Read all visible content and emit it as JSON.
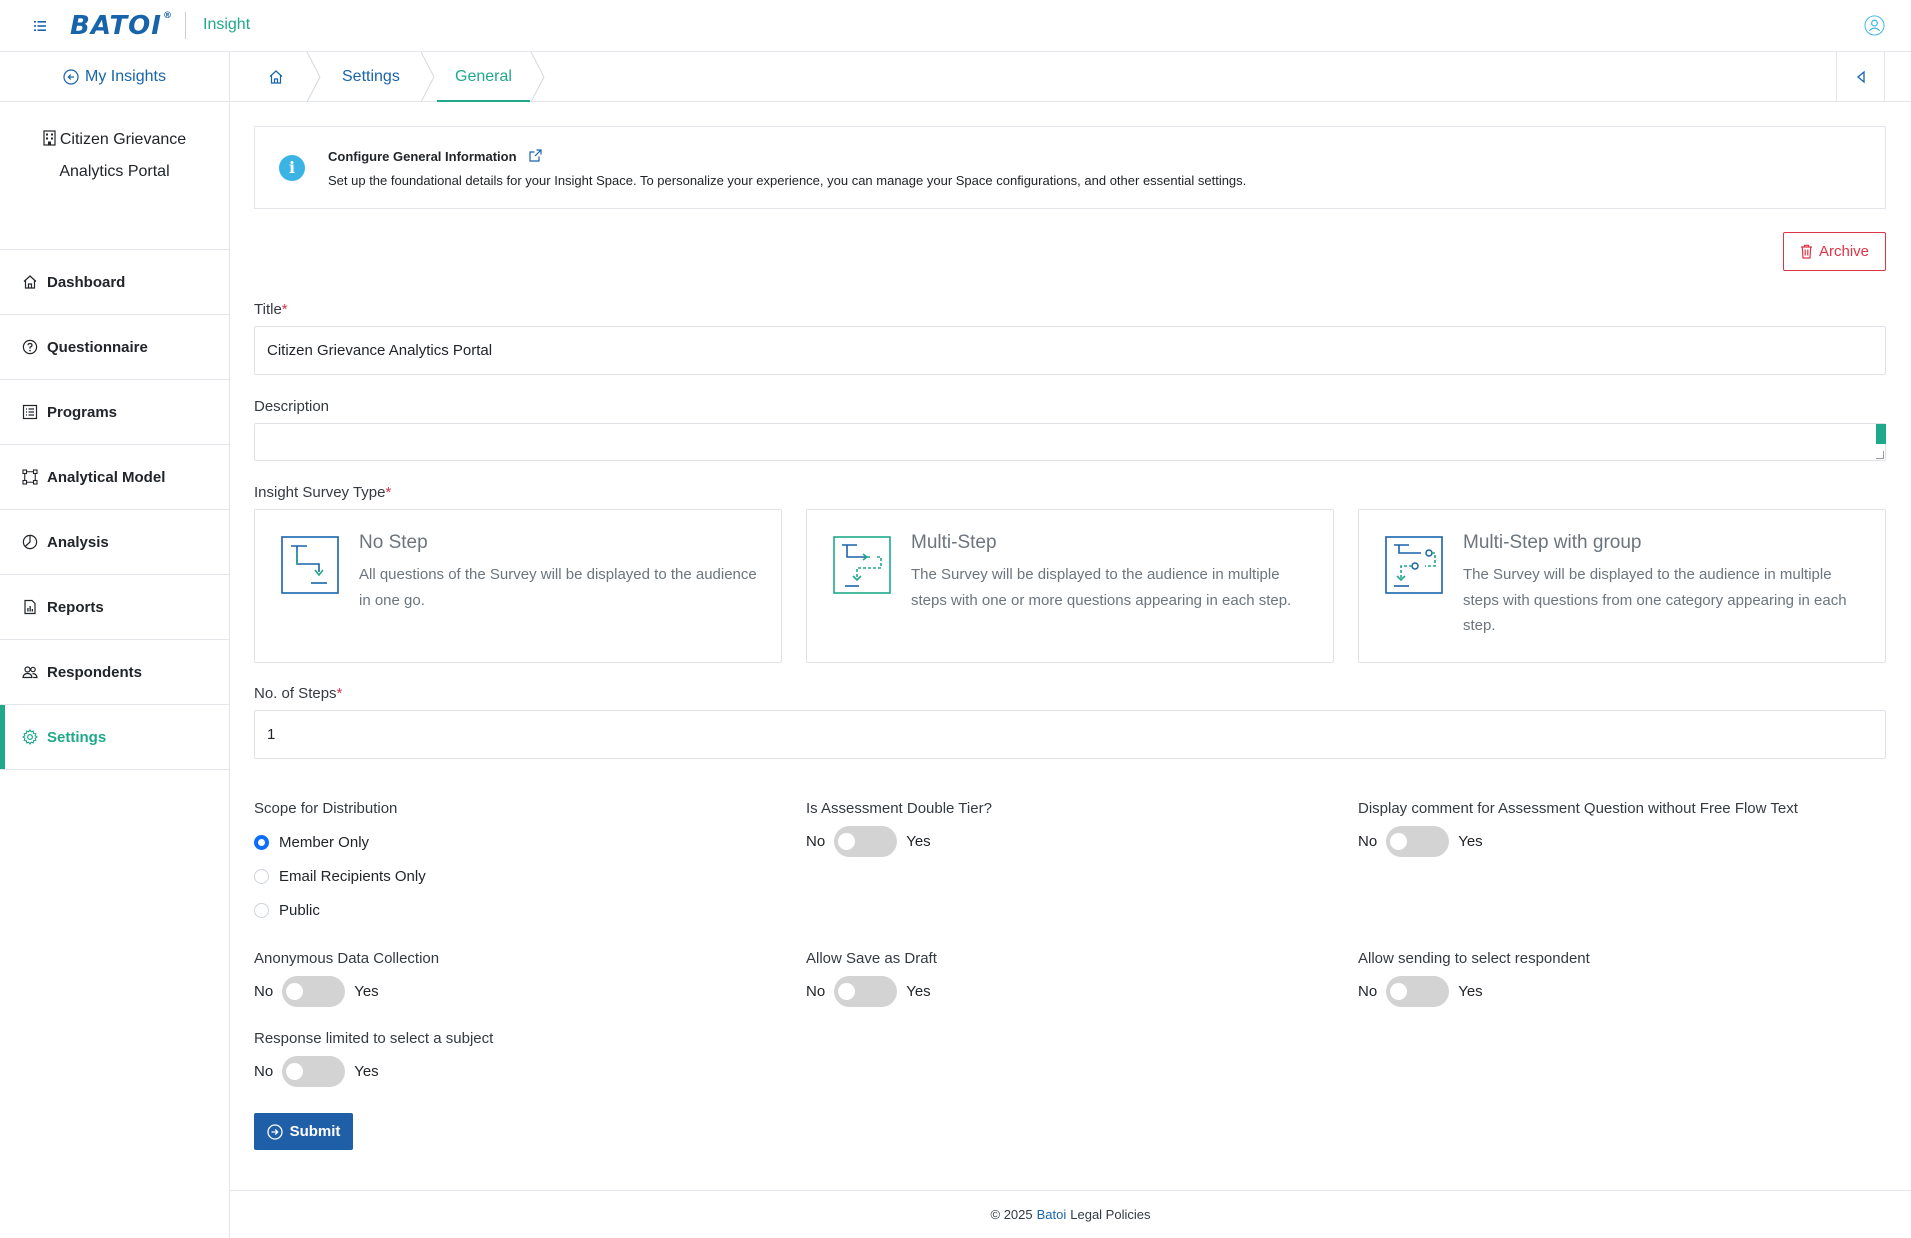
{
  "header": {
    "logo_text": "BATOI",
    "logo_mark": "®",
    "app_name": "Insight"
  },
  "sidebar": {
    "back_label": "My Insights",
    "space_name_line1": "Citizen Grievance",
    "space_name_line2": "Analytics Portal",
    "items": [
      {
        "label": "Dashboard",
        "icon": "home-icon"
      },
      {
        "label": "Questionnaire",
        "icon": "question-circle-icon"
      },
      {
        "label": "Programs",
        "icon": "list-icon"
      },
      {
        "label": "Analytical Model",
        "icon": "model-icon"
      },
      {
        "label": "Analysis",
        "icon": "pie-chart-icon"
      },
      {
        "label": "Reports",
        "icon": "report-icon"
      },
      {
        "label": "Respondents",
        "icon": "users-icon"
      },
      {
        "label": "Settings",
        "icon": "gear-icon",
        "active": true
      }
    ]
  },
  "breadcrumb": {
    "items": [
      "Settings",
      "General"
    ]
  },
  "info": {
    "title": "Configure General Information",
    "text": "Set up the foundational details for your Insight Space. To personalize your experience, you can manage your Space configurations, and other essential settings."
  },
  "archive_label": "Archive",
  "form": {
    "title_label": "Title",
    "title_value": "Citizen Grievance Analytics Portal",
    "description_label": "Description",
    "description_value": "",
    "survey_type_label": "Insight Survey Type",
    "survey_types": [
      {
        "title": "No Step",
        "desc": "All questions of the Survey will be displayed to the audience in one go."
      },
      {
        "title": "Multi-Step",
        "desc": "The Survey will be displayed to the audience in multiple steps with one or more questions appearing in each step."
      },
      {
        "title": "Multi-Step with group",
        "desc": "The Survey will be displayed to the audience in multiple steps with questions from one category appearing in each step."
      }
    ],
    "steps_label": "No. of Steps",
    "steps_value": "1",
    "scope_label": "Scope for Distribution",
    "scope_options": [
      "Member Only",
      "Email Recipients Only",
      "Public"
    ],
    "scope_selected": "Member Only",
    "toggles": [
      {
        "label": "Is Assessment Double Tier?",
        "no": "No",
        "yes": "Yes"
      },
      {
        "label": "Display comment for Assessment Question without Free Flow Text",
        "no": "No",
        "yes": "Yes"
      },
      {
        "label": "Anonymous Data Collection",
        "no": "No",
        "yes": "Yes"
      },
      {
        "label": "Allow Save as Draft",
        "no": "No",
        "yes": "Yes"
      },
      {
        "label": "Allow sending to select respondent",
        "no": "No",
        "yes": "Yes"
      },
      {
        "label": "Response limited to select a subject",
        "no": "No",
        "yes": "Yes"
      }
    ],
    "submit_label": "Submit"
  },
  "footer": {
    "copyright": "© 2025",
    "brand": "Batoi",
    "legal": "Legal Policies"
  },
  "colors": {
    "primary": "#1864ab",
    "accent": "#20a88a",
    "danger": "#dc3545",
    "radio": "#0d6efd",
    "submit": "#1f5fa8"
  }
}
